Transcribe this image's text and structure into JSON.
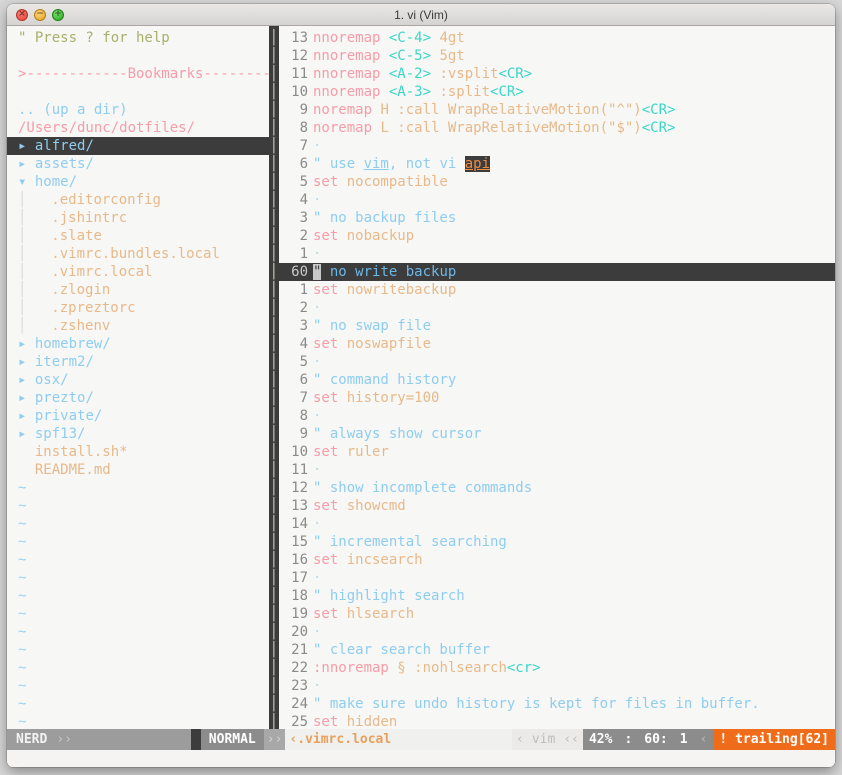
{
  "window": {
    "title": "1. vi (Vim)",
    "traffic_lights": [
      {
        "name": "close-button",
        "glyph": "×",
        "color": "#e0443a"
      },
      {
        "name": "minimize-button",
        "glyph": "−",
        "color": "#e5a31c"
      },
      {
        "name": "maximize-button",
        "glyph": "+",
        "color": "#28a81e"
      }
    ]
  },
  "nerdtree": {
    "help_text": "\" Press ? for help",
    "blank1": "",
    "bookmarks_header": ">------------Bookmarks------------",
    "blank2": "",
    "up_a_dir": ".. (up a dir)",
    "root_path": "/Users/dunc/dotfiles/",
    "arrow_closed": "▸",
    "arrow_open": "▾",
    "entries": [
      {
        "label": "alfred/",
        "type": "dir",
        "state": "closed",
        "selected": true,
        "indent": 0
      },
      {
        "label": "assets/",
        "type": "dir",
        "state": "closed",
        "selected": false,
        "indent": 0
      },
      {
        "label": "home/",
        "type": "dir",
        "state": "open",
        "selected": false,
        "indent": 0
      },
      {
        "label": ".editorconfig",
        "type": "file",
        "state": "",
        "selected": false,
        "indent": 1
      },
      {
        "label": ".jshintrc",
        "type": "file",
        "state": "",
        "selected": false,
        "indent": 1
      },
      {
        "label": ".slate",
        "type": "file",
        "state": "",
        "selected": false,
        "indent": 1
      },
      {
        "label": ".vimrc.bundles.local",
        "type": "file",
        "state": "",
        "selected": false,
        "indent": 1
      },
      {
        "label": ".vimrc.local",
        "type": "file",
        "state": "",
        "selected": false,
        "indent": 1
      },
      {
        "label": ".zlogin",
        "type": "file",
        "state": "",
        "selected": false,
        "indent": 1
      },
      {
        "label": ".zpreztorc",
        "type": "file",
        "state": "",
        "selected": false,
        "indent": 1
      },
      {
        "label": ".zshenv",
        "type": "file",
        "state": "",
        "selected": false,
        "indent": 1
      },
      {
        "label": "homebrew/",
        "type": "dir",
        "state": "closed",
        "selected": false,
        "indent": 0
      },
      {
        "label": "iterm2/",
        "type": "dir",
        "state": "closed",
        "selected": false,
        "indent": 0
      },
      {
        "label": "osx/",
        "type": "dir",
        "state": "closed",
        "selected": false,
        "indent": 0
      },
      {
        "label": "prezto/",
        "type": "dir",
        "state": "closed",
        "selected": false,
        "indent": 0
      },
      {
        "label": "private/",
        "type": "dir",
        "state": "closed",
        "selected": false,
        "indent": 0
      },
      {
        "label": "spf13/",
        "type": "dir",
        "state": "closed",
        "selected": false,
        "indent": 0
      },
      {
        "label": "install.sh*",
        "type": "file",
        "state": "",
        "selected": false,
        "indent": 0
      },
      {
        "label": "README.md",
        "type": "file",
        "state": "",
        "selected": false,
        "indent": 0
      }
    ],
    "tilde_count": 14,
    "tilde_glyph": "~"
  },
  "splitter": {
    "glyph": "│",
    "rows": 39
  },
  "buffer": {
    "lines": [
      {
        "num": "13",
        "current": false,
        "tokens": [
          {
            "t": "nnoremap ",
            "c": "c-set"
          },
          {
            "t": "<C-4>",
            "c": "c-special"
          },
          {
            "t": " 4gt",
            "c": "c-val"
          }
        ]
      },
      {
        "num": "12",
        "current": false,
        "tokens": [
          {
            "t": "nnoremap ",
            "c": "c-set"
          },
          {
            "t": "<C-5>",
            "c": "c-special"
          },
          {
            "t": " 5gt",
            "c": "c-val"
          }
        ]
      },
      {
        "num": "11",
        "current": false,
        "tokens": [
          {
            "t": "nnoremap ",
            "c": "c-set"
          },
          {
            "t": "<A-2>",
            "c": "c-special"
          },
          {
            "t": " :vsplit",
            "c": "c-val"
          },
          {
            "t": "<CR>",
            "c": "c-special"
          }
        ]
      },
      {
        "num": "10",
        "current": false,
        "tokens": [
          {
            "t": "nnoremap ",
            "c": "c-set"
          },
          {
            "t": "<A-3>",
            "c": "c-special"
          },
          {
            "t": " :split",
            "c": "c-val"
          },
          {
            "t": "<CR>",
            "c": "c-special"
          }
        ]
      },
      {
        "num": "9",
        "current": false,
        "tokens": [
          {
            "t": "noremap ",
            "c": "c-set"
          },
          {
            "t": "H :call WrapRelativeMotion(\"^\")",
            "c": "c-val"
          },
          {
            "t": "<CR>",
            "c": "c-special"
          }
        ]
      },
      {
        "num": "8",
        "current": false,
        "tokens": [
          {
            "t": "noremap ",
            "c": "c-set"
          },
          {
            "t": "L :call WrapRelativeMotion(\"$\")",
            "c": "c-val"
          },
          {
            "t": "<CR>",
            "c": "c-special"
          }
        ]
      },
      {
        "num": "7",
        "current": false,
        "tokens": [
          {
            "t": "·",
            "c": "c-dot"
          }
        ]
      },
      {
        "num": "6",
        "current": false,
        "tokens": [
          {
            "t": "\" use ",
            "c": "c-comment"
          },
          {
            "t": "vim",
            "c": "c-comment c-underline"
          },
          {
            "t": ", not vi ",
            "c": "c-comment"
          },
          {
            "t": "api",
            "c": "c-search"
          }
        ]
      },
      {
        "num": "5",
        "current": false,
        "tokens": [
          {
            "t": "set ",
            "c": "c-set"
          },
          {
            "t": "nocompatible",
            "c": "c-val"
          }
        ]
      },
      {
        "num": "4",
        "current": false,
        "tokens": [
          {
            "t": "·",
            "c": "c-dot"
          }
        ]
      },
      {
        "num": "3",
        "current": false,
        "tokens": [
          {
            "t": "\" no backup files",
            "c": "c-comment"
          }
        ]
      },
      {
        "num": "2",
        "current": false,
        "tokens": [
          {
            "t": "set ",
            "c": "c-set"
          },
          {
            "t": "nobackup",
            "c": "c-val"
          }
        ]
      },
      {
        "num": "1",
        "current": false,
        "tokens": [
          {
            "t": "·",
            "c": "c-dot"
          }
        ]
      },
      {
        "num": "60",
        "current": true,
        "tokens": [
          {
            "t": "\"",
            "c": "cursor-blk"
          },
          {
            "t": " no write backup",
            "c": "c-comment"
          }
        ]
      },
      {
        "num": "1",
        "current": false,
        "tokens": [
          {
            "t": "set ",
            "c": "c-set"
          },
          {
            "t": "nowritebackup",
            "c": "c-val"
          }
        ]
      },
      {
        "num": "2",
        "current": false,
        "tokens": [
          {
            "t": "·",
            "c": "c-dot"
          }
        ]
      },
      {
        "num": "3",
        "current": false,
        "tokens": [
          {
            "t": "\" no swap file",
            "c": "c-comment"
          }
        ]
      },
      {
        "num": "4",
        "current": false,
        "tokens": [
          {
            "t": "set ",
            "c": "c-set"
          },
          {
            "t": "noswapfile",
            "c": "c-val"
          }
        ]
      },
      {
        "num": "5",
        "current": false,
        "tokens": [
          {
            "t": "·",
            "c": "c-dot"
          }
        ]
      },
      {
        "num": "6",
        "current": false,
        "tokens": [
          {
            "t": "\" command history",
            "c": "c-comment"
          }
        ]
      },
      {
        "num": "7",
        "current": false,
        "tokens": [
          {
            "t": "set ",
            "c": "c-set"
          },
          {
            "t": "history=100",
            "c": "c-val"
          }
        ]
      },
      {
        "num": "8",
        "current": false,
        "tokens": [
          {
            "t": "·",
            "c": "c-dot"
          }
        ]
      },
      {
        "num": "9",
        "current": false,
        "tokens": [
          {
            "t": "\" always show cursor",
            "c": "c-comment"
          }
        ]
      },
      {
        "num": "10",
        "current": false,
        "tokens": [
          {
            "t": "set ",
            "c": "c-set"
          },
          {
            "t": "ruler",
            "c": "c-val"
          }
        ]
      },
      {
        "num": "11",
        "current": false,
        "tokens": [
          {
            "t": "·",
            "c": "c-dot"
          }
        ]
      },
      {
        "num": "12",
        "current": false,
        "tokens": [
          {
            "t": "\" show incomplete commands",
            "c": "c-comment"
          }
        ]
      },
      {
        "num": "13",
        "current": false,
        "tokens": [
          {
            "t": "set ",
            "c": "c-set"
          },
          {
            "t": "showcmd",
            "c": "c-val"
          }
        ]
      },
      {
        "num": "14",
        "current": false,
        "tokens": [
          {
            "t": "·",
            "c": "c-dot"
          }
        ]
      },
      {
        "num": "15",
        "current": false,
        "tokens": [
          {
            "t": "\" incremental searching",
            "c": "c-comment"
          }
        ]
      },
      {
        "num": "16",
        "current": false,
        "tokens": [
          {
            "t": "set ",
            "c": "c-set"
          },
          {
            "t": "incsearch",
            "c": "c-val"
          }
        ]
      },
      {
        "num": "17",
        "current": false,
        "tokens": [
          {
            "t": "·",
            "c": "c-dot"
          }
        ]
      },
      {
        "num": "18",
        "current": false,
        "tokens": [
          {
            "t": "\" highlight search",
            "c": "c-comment"
          }
        ]
      },
      {
        "num": "19",
        "current": false,
        "tokens": [
          {
            "t": "set ",
            "c": "c-set"
          },
          {
            "t": "hlsearch",
            "c": "c-val"
          }
        ]
      },
      {
        "num": "20",
        "current": false,
        "tokens": [
          {
            "t": "·",
            "c": "c-dot"
          }
        ]
      },
      {
        "num": "21",
        "current": false,
        "tokens": [
          {
            "t": "\" clear search buffer",
            "c": "c-comment"
          }
        ]
      },
      {
        "num": "22",
        "current": false,
        "tokens": [
          {
            "t": ":nnoremap ",
            "c": "c-set"
          },
          {
            "t": "§ :nohlsearch",
            "c": "c-val"
          },
          {
            "t": "<cr>",
            "c": "c-special"
          }
        ]
      },
      {
        "num": "23",
        "current": false,
        "tokens": [
          {
            "t": "·",
            "c": "c-dot"
          }
        ]
      },
      {
        "num": "24",
        "current": false,
        "tokens": [
          {
            "t": "\" make sure undo history is kept for files in buffer.",
            "c": "c-comment"
          }
        ]
      },
      {
        "num": "25",
        "current": false,
        "tokens": [
          {
            "t": "set ",
            "c": "c-set"
          },
          {
            "t": "hidden",
            "c": "c-val"
          }
        ]
      }
    ]
  },
  "statusline": {
    "nerd_label": "NERD",
    "nerd_arrows": "››",
    "mode": "NORMAL",
    "mode_arrows": "››",
    "filename": "‹.vimrc.local",
    "filetype_left": "‹",
    "filetype": "vim",
    "filetype_right": "‹‹",
    "percent": "42%",
    "ruler_sep": ":",
    "line": "60:",
    "col": "1",
    "ruler_arrow": "‹",
    "warning": "! trailing[62]",
    "colors": {
      "warning_bg": "#ef6c1a",
      "mode_bg": "#8c8c8c",
      "nerd_bg": "#9c9c9c",
      "filename_fg": "#e8a05c"
    }
  }
}
